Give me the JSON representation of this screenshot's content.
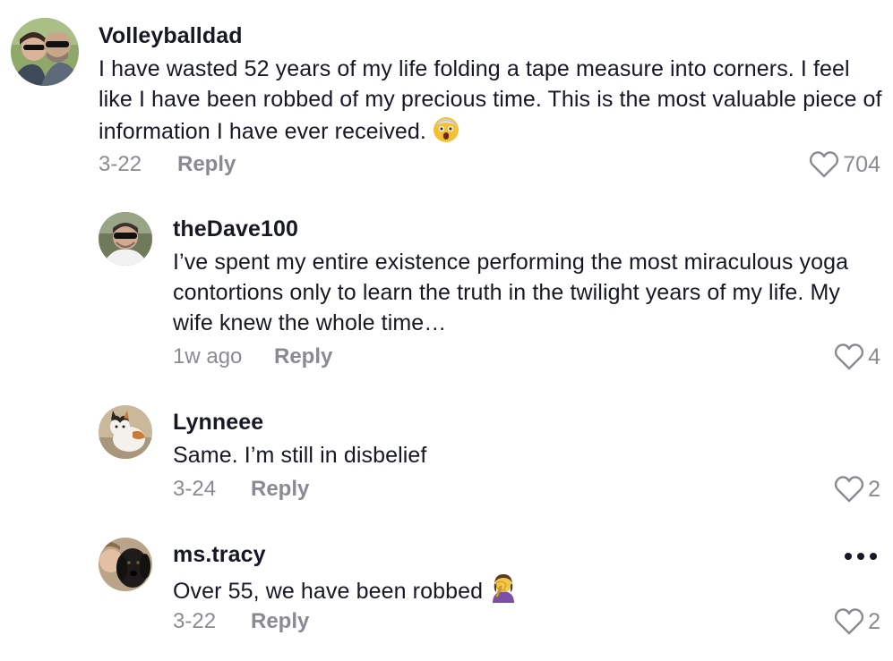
{
  "comments": [
    {
      "username": "Volleyballdad",
      "text": "I have wasted 52 years of my life folding a tape measure into corners. I feel like I have been robbed of my precious time. This is the most valuable piece of information I have ever received.",
      "emoji": "astonished-face",
      "date": "3-22",
      "reply_label": "Reply",
      "likes": "704"
    },
    {
      "username": "theDave100",
      "text": "I’ve spent my entire existence performing the most miraculous yoga contortions only to learn the truth in the twilight years of my life. My wife knew the whole time…",
      "date": "1w ago",
      "reply_label": "Reply",
      "likes": "4"
    },
    {
      "username": "Lynneee",
      "text": "Same. I’m still in disbelief",
      "date": "3-24",
      "reply_label": "Reply",
      "likes": "2"
    },
    {
      "username": "ms.tracy",
      "text": "Over 55, we have been robbed",
      "emoji": "person-facepalming",
      "date": "3-22",
      "reply_label": "Reply",
      "likes": "2"
    }
  ],
  "icons": {
    "like": "heart-outline-icon",
    "more": "more-dots-icon"
  },
  "colors": {
    "primary_text": "#161823",
    "secondary_text": "#8a8b91"
  }
}
